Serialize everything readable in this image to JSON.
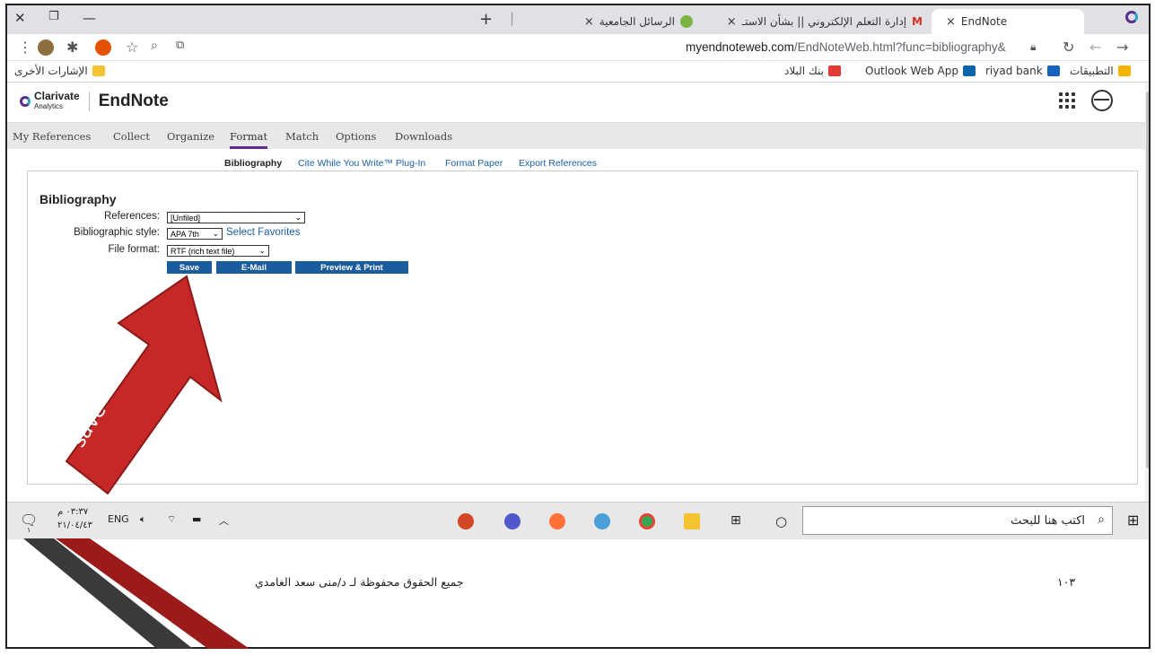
{
  "titlebar": {
    "tabs": [
      {
        "label": "EndNote",
        "active": true
      },
      {
        "label": "إدارة التعلم الإلكتروني || بشأن الاستـ",
        "active": false
      },
      {
        "label": "الرسائل الجامعية",
        "active": false
      }
    ],
    "new_tab": "+",
    "close": "×"
  },
  "address": {
    "url_host": "myendnoteweb.com",
    "url_path": "/EndNoteWeb.html?func=bibliography&"
  },
  "bookmarks": [
    {
      "label": "التطبيقات",
      "color": "#f4b400"
    },
    {
      "label": "riyad bank",
      "color": "#1565c0"
    },
    {
      "label": "Outlook Web App",
      "color": "#0a64ad"
    },
    {
      "label": "بنك البلاد",
      "color": "#e53935"
    }
  ],
  "other_bookmarks": "الإشارات الأخرى",
  "endnote": {
    "brand": "Clarivate",
    "brand_sub": "Analytics",
    "title": "EndNote",
    "menu": [
      "My References",
      "Collect",
      "Organize",
      "Format",
      "Match",
      "Options",
      "Downloads"
    ],
    "submenu": [
      "Bibliography",
      "Cite While You Write™ Plug-In",
      "Format Paper",
      "Export References"
    ]
  },
  "form": {
    "heading": "Bibliography",
    "references_label": "References:",
    "references_value": "[Unfiled]",
    "style_label": "Bibliographic style:",
    "style_value": "APA 7th",
    "favorites_link": "Select Favorites",
    "format_label": "File format:",
    "format_value": "RTF (rich text file)",
    "save": "Save",
    "email": "E-Mail",
    "preview": "Preview & Print"
  },
  "annotation": {
    "line1": "ثم نضغط",
    "line2": "save",
    "arrow_color": "#c62828"
  },
  "taskbar": {
    "search_placeholder": "اكتب هنا للبحث",
    "lang": "ENG",
    "time": "٠٣:٣٧ م",
    "date": "٢١/٠٤/٤٣",
    "notif_count": "١"
  },
  "footer": {
    "credit": "جميع الحقوق محفوظة لـ د/منى سعد الغامدي",
    "page_number": "١٠٣"
  }
}
